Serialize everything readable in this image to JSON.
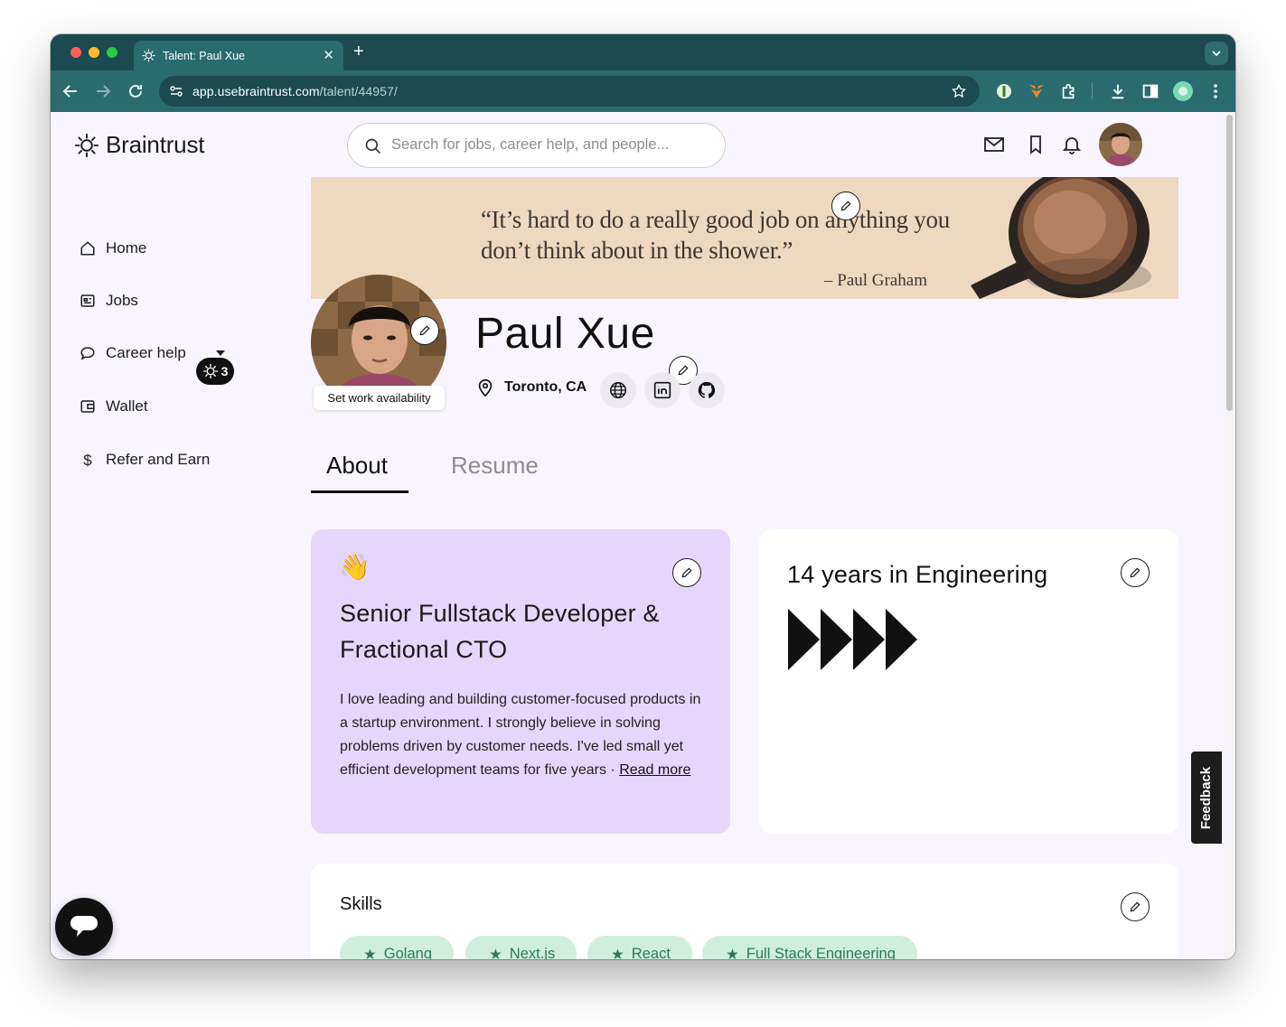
{
  "browser": {
    "tab_title": "Talent: Paul Xue",
    "url_host": "app.usebraintrust.com",
    "url_path": "/talent/44957/"
  },
  "brand": {
    "name": "Braintrust"
  },
  "sidebar": {
    "items": [
      {
        "label": "Home",
        "icon": "home-icon"
      },
      {
        "label": "Jobs",
        "icon": "jobs-icon"
      },
      {
        "label": "Career help",
        "icon": "chat-bubble-icon"
      },
      {
        "label": "Wallet",
        "icon": "wallet-icon",
        "badge": "3"
      },
      {
        "label": "Refer and Earn",
        "icon": "dollar-icon"
      }
    ]
  },
  "search": {
    "placeholder": "Search for jobs, career help, and people..."
  },
  "banner": {
    "quote_line1": "“It’s hard to do a really good job on anything you",
    "quote_line2": "don’t think about in the shower.”",
    "author": "– Paul Graham"
  },
  "profile": {
    "name": "Paul Xue",
    "location": "Toronto, CA",
    "availability_label": "Set work availability"
  },
  "tabs": {
    "about": "About",
    "resume": "Resume"
  },
  "about_card": {
    "emoji": "👋",
    "headline": "Senior Fullstack Developer & Fractional CTO",
    "bio": "I love leading and building customer-focused products in a startup environment. I strongly believe in solving problems driven by customer needs. I've led small yet efficient development teams for five years",
    "separator": " · ",
    "read_more": "Read more"
  },
  "experience_card": {
    "title": "14 years in Engineering"
  },
  "skills": {
    "title": "Skills",
    "items": [
      "Golang",
      "Next.js",
      "React",
      "Full Stack Engineering"
    ]
  },
  "feedback_label": "Feedback",
  "colors": {
    "chrome": "#1b4a50",
    "toolbar": "#2a6b70",
    "page_bg": "#f8f5ff",
    "about_card": "#e5d6fb",
    "skill_chip": "#cfeedd",
    "skill_text": "#2f7a55"
  }
}
